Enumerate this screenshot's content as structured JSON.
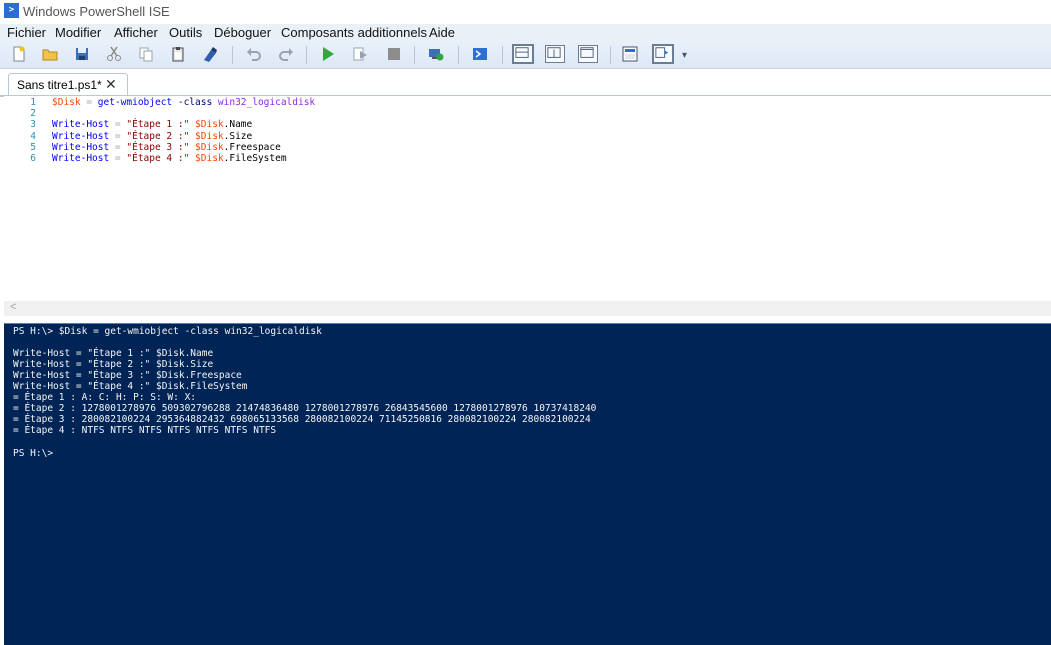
{
  "window": {
    "title": "Windows PowerShell ISE",
    "app_icon_glyph": ">"
  },
  "menu": [
    "Fichier",
    "Modifier",
    "Afficher",
    "Outils",
    "Déboguer",
    "Composants additionnels",
    "Aide"
  ],
  "toolbar": {
    "icons": [
      "new-file-icon",
      "open-folder-icon",
      "save-icon",
      "cut-icon",
      "copy-icon",
      "paste-icon",
      "clear-console-icon",
      "undo-icon",
      "redo-icon",
      "run-script-icon",
      "run-selection-icon",
      "stop-icon",
      "new-remote-tab-icon",
      "start-powershell-icon",
      "show-script-pane-top-icon",
      "show-script-pane-right-icon",
      "show-script-pane-maximized-icon",
      "show-command-window-icon",
      "show-command-addon-icon"
    ],
    "overflow_glyph": "▾"
  },
  "tabs": [
    {
      "label": "Sans titre1.ps1*",
      "close_glyph": "✕"
    }
  ],
  "editor": {
    "lines": [
      {
        "num": "1",
        "tokens": [
          {
            "cls": "var",
            "text": "$Disk"
          },
          {
            "cls": "op",
            "text": " = "
          },
          {
            "cls": "kw",
            "text": "get-wmiobject"
          },
          {
            "cls": "param",
            "text": " -class"
          },
          {
            "cls": "arg",
            "text": " win32_logicaldisk"
          }
        ]
      },
      {
        "num": "2",
        "tokens": []
      },
      {
        "num": "3",
        "tokens": [
          {
            "cls": "kw",
            "text": "Write-Host"
          },
          {
            "cls": "op",
            "text": " = "
          },
          {
            "cls": "str",
            "text": "\"Étape 1 :\""
          },
          {
            "cls": "prop",
            "text": " "
          },
          {
            "cls": "var",
            "text": "$Disk"
          },
          {
            "cls": "prop",
            "text": ".Name"
          }
        ]
      },
      {
        "num": "4",
        "tokens": [
          {
            "cls": "kw",
            "text": "Write-Host"
          },
          {
            "cls": "op",
            "text": " = "
          },
          {
            "cls": "str",
            "text": "\"Étape 2 :\""
          },
          {
            "cls": "prop",
            "text": " "
          },
          {
            "cls": "var",
            "text": "$Disk"
          },
          {
            "cls": "prop",
            "text": ".Size"
          }
        ]
      },
      {
        "num": "5",
        "tokens": [
          {
            "cls": "kw",
            "text": "Write-Host"
          },
          {
            "cls": "op",
            "text": " = "
          },
          {
            "cls": "str",
            "text": "\"Étape 3 :\""
          },
          {
            "cls": "prop",
            "text": " "
          },
          {
            "cls": "var",
            "text": "$Disk"
          },
          {
            "cls": "prop",
            "text": ".Freespace"
          }
        ]
      },
      {
        "num": "6",
        "tokens": [
          {
            "cls": "kw",
            "text": "Write-Host"
          },
          {
            "cls": "op",
            "text": " = "
          },
          {
            "cls": "str",
            "text": "\"Étape 4 :\""
          },
          {
            "cls": "prop",
            "text": " "
          },
          {
            "cls": "var",
            "text": "$Disk"
          },
          {
            "cls": "prop",
            "text": ".FileSystem"
          }
        ]
      }
    ]
  },
  "scrollbar": {
    "left_arrow_glyph": "<"
  },
  "console": {
    "lines": [
      "PS H:\\> $Disk = get-wmiobject -class win32_logicaldisk",
      "",
      "Write-Host = \"Étape 1 :\" $Disk.Name",
      "Write-Host = \"Étape 2 :\" $Disk.Size",
      "Write-Host = \"Étape 3 :\" $Disk.Freespace",
      "Write-Host = \"Étape 4 :\" $Disk.FileSystem",
      "= Étape 1 : A: C: H: P: S: W: X:",
      "= Étape 2 : 1278001278976 509302796288 21474836480 1278001278976 26843545600 1278001278976 10737418240",
      "= Étape 3 : 280082100224 295364882432 698065133568 280082100224 71145250816 280082100224 280082100224",
      "= Étape 4 : NTFS NTFS NTFS NTFS NTFS NTFS NTFS",
      "",
      "PS H:\\>"
    ]
  },
  "colors": {
    "console_bg": "#012456",
    "console_fg": "#f5f5f5",
    "accent": "#2a6fd1"
  }
}
